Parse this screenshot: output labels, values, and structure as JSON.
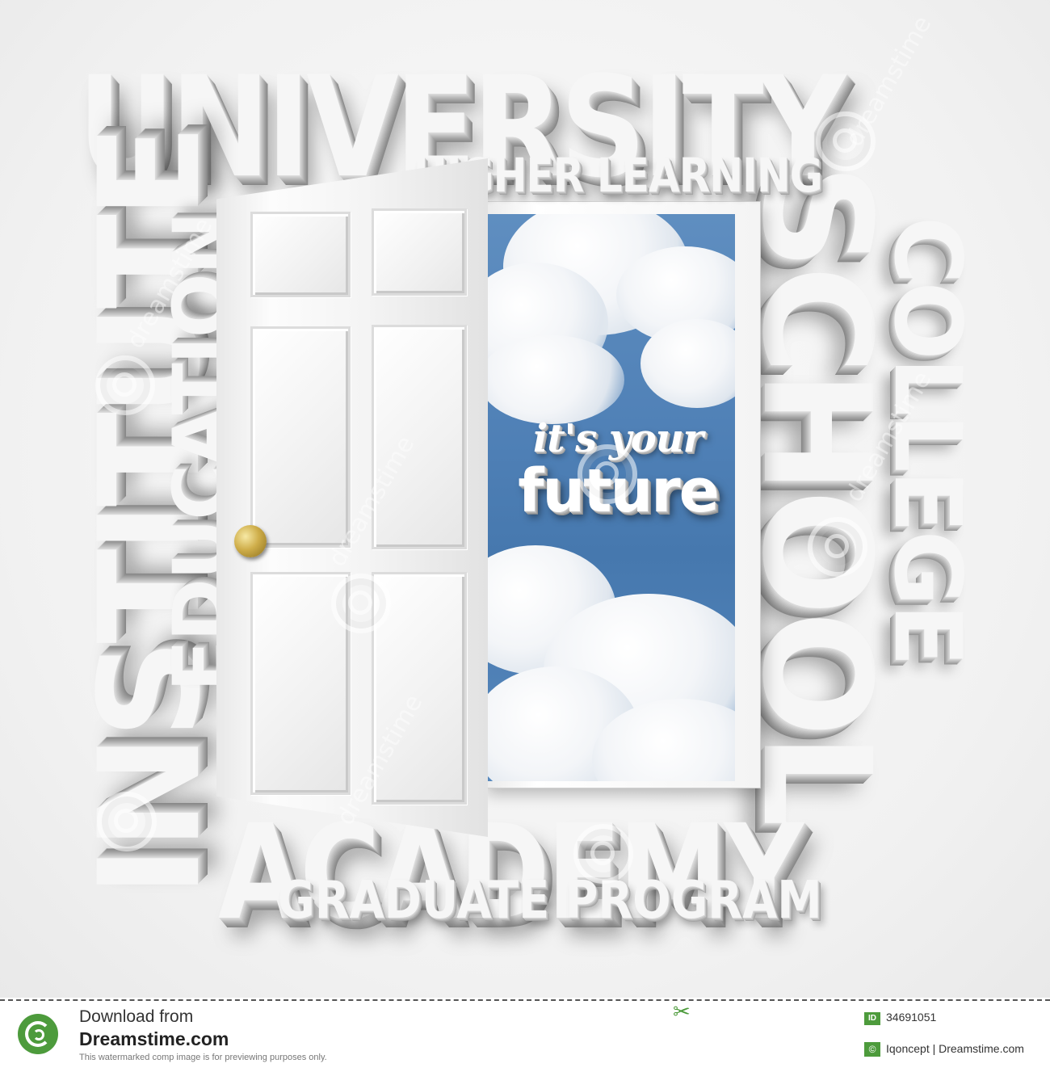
{
  "words": {
    "university": "UNIVERSITY",
    "higher_learning": "HIGHER LEARNING",
    "institute": "INSTITUTE",
    "education": "EDUCATION",
    "school": "SCHOOL",
    "college": "COLLEGE",
    "academy": "ACADEMY",
    "graduate_program": "GRADUATE PROGRAM"
  },
  "tagline": {
    "line1": "it's your",
    "line2": "future"
  },
  "watermark": {
    "text": "dreamstime"
  },
  "footer": {
    "download_text": "Download from",
    "site_name": "Dreamstime.com",
    "notice": "This watermarked comp image is for previewing purposes only.",
    "id_label": "ID",
    "image_id": "34691051",
    "copyright_symbol": "©",
    "credit": "Iqoncept | Dreamstime.com",
    "accent_color": "#4d9b3c"
  },
  "icons": {
    "logo": "dreamstime-spiral-icon",
    "scissors": "scissors-icon",
    "door_knob": "brass-door-knob"
  }
}
